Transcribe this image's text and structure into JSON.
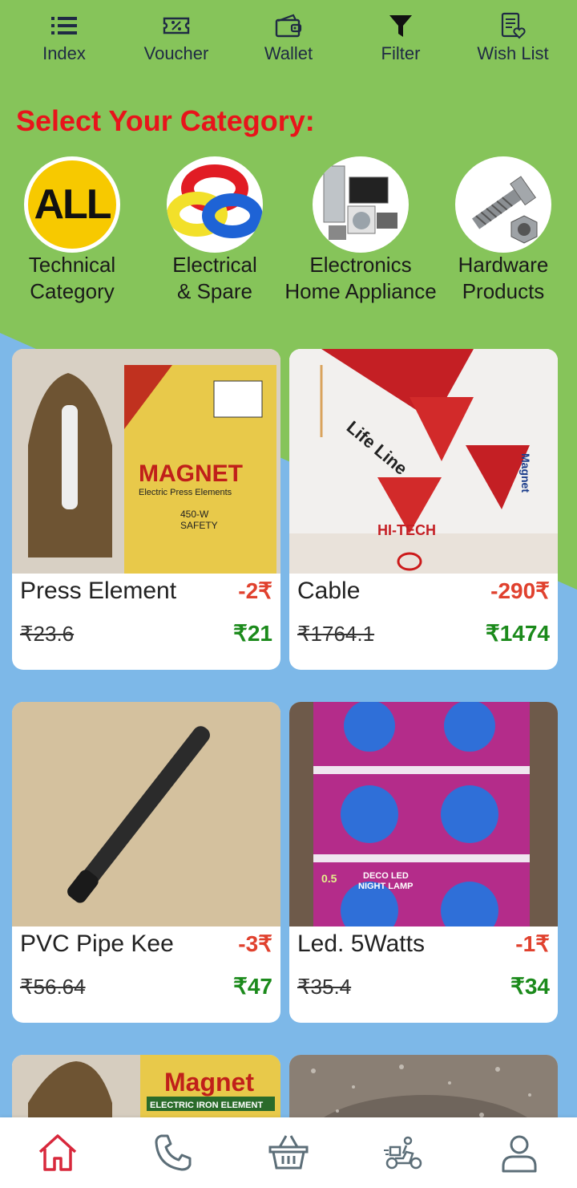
{
  "top_nav": [
    {
      "label": "Index",
      "icon": "list-icon"
    },
    {
      "label": "Voucher",
      "icon": "voucher-icon"
    },
    {
      "label": "Wallet",
      "icon": "wallet-icon"
    },
    {
      "label": "Filter",
      "icon": "filter-icon"
    },
    {
      "label": "Wish List",
      "icon": "wishlist-icon"
    }
  ],
  "category_title": "Select Your Category:",
  "categories": [
    {
      "line1": "Technical",
      "line2": "Category",
      "badge": "ALL"
    },
    {
      "line1": "Electrical",
      "line2": "& Spare"
    },
    {
      "line1": "Electronics",
      "line2": "Home Appliance"
    },
    {
      "line1": "Hardware",
      "line2": "Products"
    }
  ],
  "products": [
    {
      "name": "Press Element",
      "discount": "-2₹",
      "old_price": "₹23.6",
      "price": "₹21"
    },
    {
      "name": "Cable",
      "discount": "-290₹",
      "old_price": "₹1764.1",
      "price": "₹1474"
    },
    {
      "name": "PVC Pipe Kee",
      "discount": "-3₹",
      "old_price": "₹56.64",
      "price": "₹47"
    },
    {
      "name": "Led. 5Watts",
      "discount": "-1₹",
      "old_price": "₹35.4",
      "price": "₹34"
    }
  ],
  "product_images": {
    "magnet_brand": "MAGNET",
    "magnet_subtitle": "Electric Press Elements",
    "magnet_watts": "450-W",
    "magnet_safety": "SAFETY",
    "cable_brand": "Life Line",
    "cable_maker": "HI-TECH",
    "cable_side": "Magnet",
    "led_label": "DECO LED",
    "led_label2": "NIGHT LAMP",
    "led_watt": "0.5",
    "partial_brand": "Magnet",
    "partial_sub": "ELECTRIC IRON ELEMENT"
  },
  "bottom_nav": [
    "home-icon",
    "phone-icon",
    "basket-icon",
    "delivery-icon",
    "user-icon"
  ],
  "colors": {
    "header_green": "#86c45a",
    "body_blue": "#7db8e8",
    "title_red": "#e8141b",
    "price_green": "#1b8a1b",
    "discount_red": "#e0412e",
    "home_active": "#d8283c"
  }
}
